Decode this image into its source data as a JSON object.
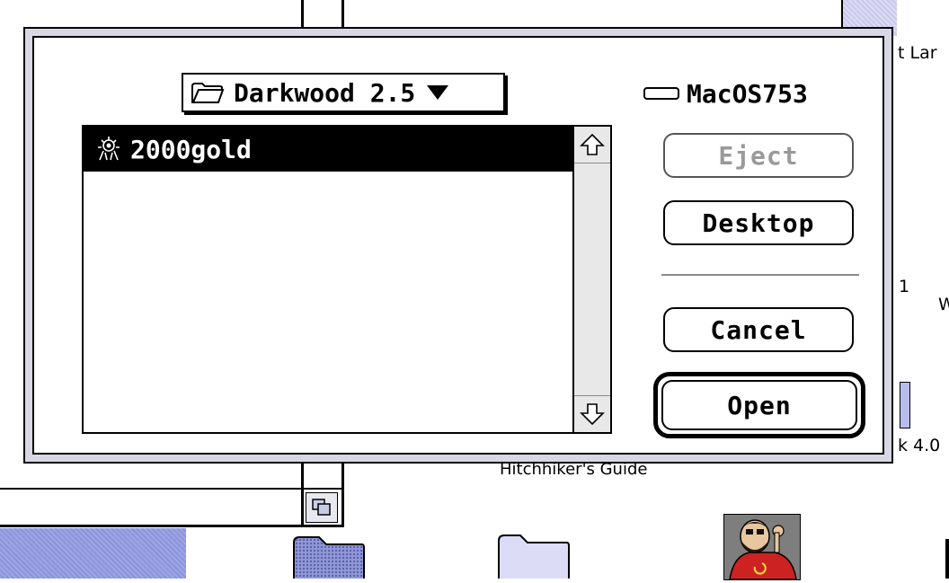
{
  "dialog": {
    "folder_popup": {
      "label": "Darkwood 2.5",
      "icon": "folder-icon",
      "dropdown_icon": "triangle-down-icon"
    },
    "volume": {
      "icon": "disk-icon",
      "name": "MacOS753"
    },
    "file_list": {
      "items": [
        {
          "name": "2000gold",
          "icon": "application-icon",
          "selected": true
        }
      ]
    },
    "buttons": {
      "eject": "Eject",
      "desktop": "Desktop",
      "cancel": "Cancel",
      "open": "Open"
    }
  },
  "desktop": {
    "labels": {
      "top_right": "t Lar",
      "middle_right_1": "1",
      "middle_right_w": "W",
      "lower_right": "k 4.0",
      "hitchhiker": "Hitchhiker's Guide"
    }
  },
  "colors": {
    "selection": "#000000",
    "desktop_pattern": "#9fa6e6",
    "dialog_frame": "#d8d8e4"
  }
}
